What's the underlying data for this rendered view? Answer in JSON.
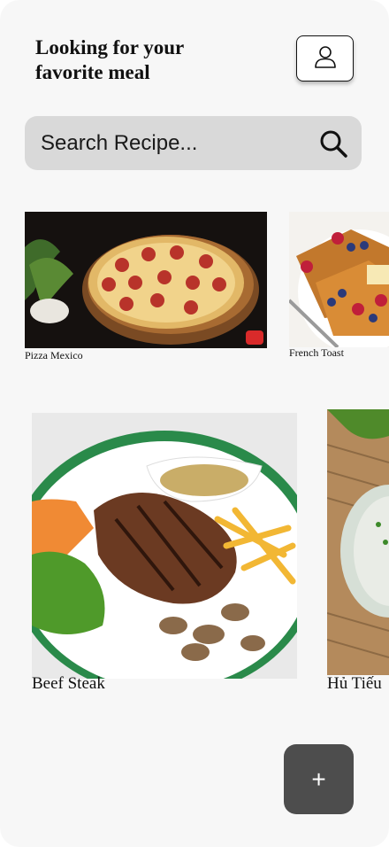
{
  "header": {
    "title": "Looking  for your\nfavorite meal"
  },
  "search": {
    "placeholder": "Search Recipe..."
  },
  "row1": [
    {
      "name": "Pizza Mexico"
    },
    {
      "name": "French Toast"
    }
  ],
  "row2": [
    {
      "name": "Beef Steak"
    },
    {
      "name": "Hủ Tiếu"
    }
  ],
  "fab": {
    "label": "+"
  }
}
